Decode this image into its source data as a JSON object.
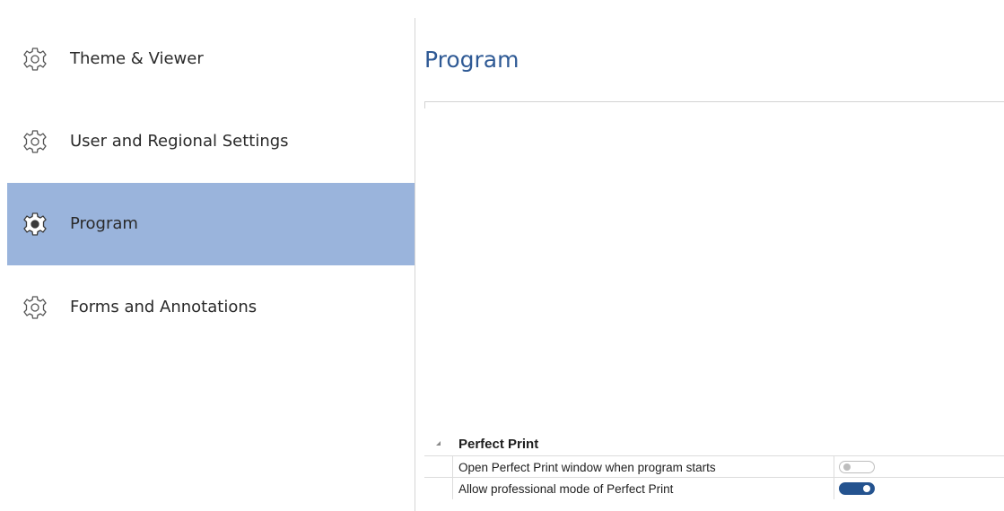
{
  "sidebar": {
    "items": [
      {
        "label": "Theme & Viewer",
        "icon": "gear-icon",
        "selected": false
      },
      {
        "label": "User and Regional Settings",
        "icon": "gear-icon",
        "selected": false
      },
      {
        "label": "Program",
        "icon": "gear-icon",
        "selected": true
      },
      {
        "label": "Forms and Annotations",
        "icon": "gear-icon",
        "selected": false
      }
    ],
    "selected_color": "#9ab4dc"
  },
  "main": {
    "title": "Program",
    "title_color": "#2f5a95",
    "property_groups": [
      {
        "title": "Perfect Print",
        "expanded": true,
        "properties": [
          {
            "name": "Open Perfect Print window when program starts",
            "value": false
          },
          {
            "name": "Allow professional mode of Perfect Print",
            "value": true
          }
        ]
      }
    ]
  },
  "colors": {
    "toggle_on": "#24538f",
    "toggle_off": "#bdbdbd"
  }
}
